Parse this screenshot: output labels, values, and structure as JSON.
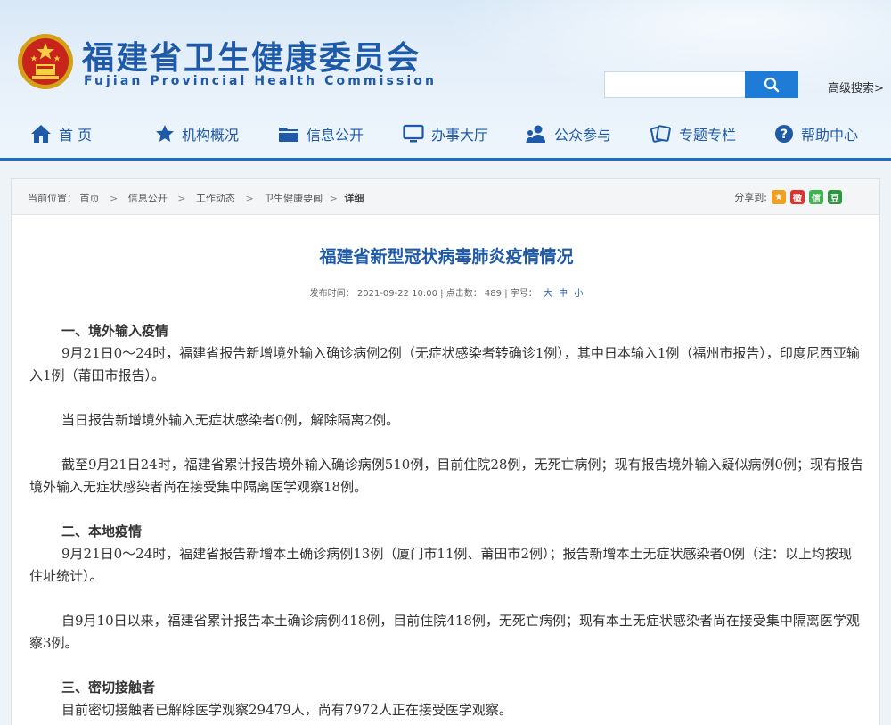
{
  "header": {
    "title": "福建省卫生健康委员会",
    "subtitle": "Fujian Provincial Health Commission",
    "search": {
      "placeholder": "",
      "button_icon": "search-icon"
    },
    "advanced_search": "高级搜索>"
  },
  "nav": [
    {
      "label": "首 页",
      "icon": "home-icon"
    },
    {
      "label": "机构概况",
      "icon": "star-icon"
    },
    {
      "label": "信息公开",
      "icon": "folder-icon"
    },
    {
      "label": "办事大厅",
      "icon": "monitor-icon"
    },
    {
      "label": "公众参与",
      "icon": "people-icon"
    },
    {
      "label": "专题专栏",
      "icon": "cards-icon"
    },
    {
      "label": "帮助中心",
      "icon": "help-icon"
    }
  ],
  "breadcrumb": {
    "prefix": "当前位置：",
    "items": [
      "首页",
      "信息公开",
      "工作动态",
      "卫生健康要闻"
    ],
    "current": "详细"
  },
  "share": {
    "label": "分享到:",
    "targets": [
      {
        "name": "qzone",
        "color": "#f0a020",
        "glyph": "★"
      },
      {
        "name": "weibo",
        "color": "#e0312a",
        "glyph": "微"
      },
      {
        "name": "wechat",
        "color": "#3fb34f",
        "glyph": "信"
      },
      {
        "name": "douban",
        "color": "#2e963d",
        "glyph": "豆"
      }
    ]
  },
  "article": {
    "title": "福建省新型冠状病毒肺炎疫情情况",
    "meta": {
      "published_label": "发布时间：",
      "published": "2021-09-22 10:00",
      "clicks_label": "点击数：",
      "clicks": "489",
      "fontsize_label": "字号：",
      "sizes": [
        "大",
        "中",
        "小"
      ]
    },
    "sections": [
      {
        "heading": "一、境外输入疫情",
        "paragraphs": [
          "9月21日0～24时，福建省报告新增境外输入确诊病例2例（无症状感染者转确诊1例），其中日本输入1例（福州市报告），印度尼西亚输入1例（莆田市报告）。",
          "当日报告新增境外输入无症状感染者0例，解除隔离2例。",
          "截至9月21日24时，福建省累计报告境外输入确诊病例510例，目前住院28例，无死亡病例；现有报告境外输入疑似病例0例；现有报告境外输入无症状感染者尚在接受集中隔离医学观察18例。"
        ]
      },
      {
        "heading": "二、本地疫情",
        "paragraphs": [
          "9月21日0～24时，福建省报告新增本土确诊病例13例（厦门市11例、莆田市2例）；报告新增本土无症状感染者0例（注：以上均按现住址统计）。",
          "自9月10日以来，福建省累计报告本土确诊病例418例，目前住院418例，无死亡病例；现有本土无症状感染者尚在接受集中隔离医学观察3例。"
        ]
      },
      {
        "heading": "三、密切接触者",
        "paragraphs": [
          "目前密切接触者已解除医学观察29479人，尚有7972人正在接受医学观察。"
        ]
      }
    ]
  }
}
